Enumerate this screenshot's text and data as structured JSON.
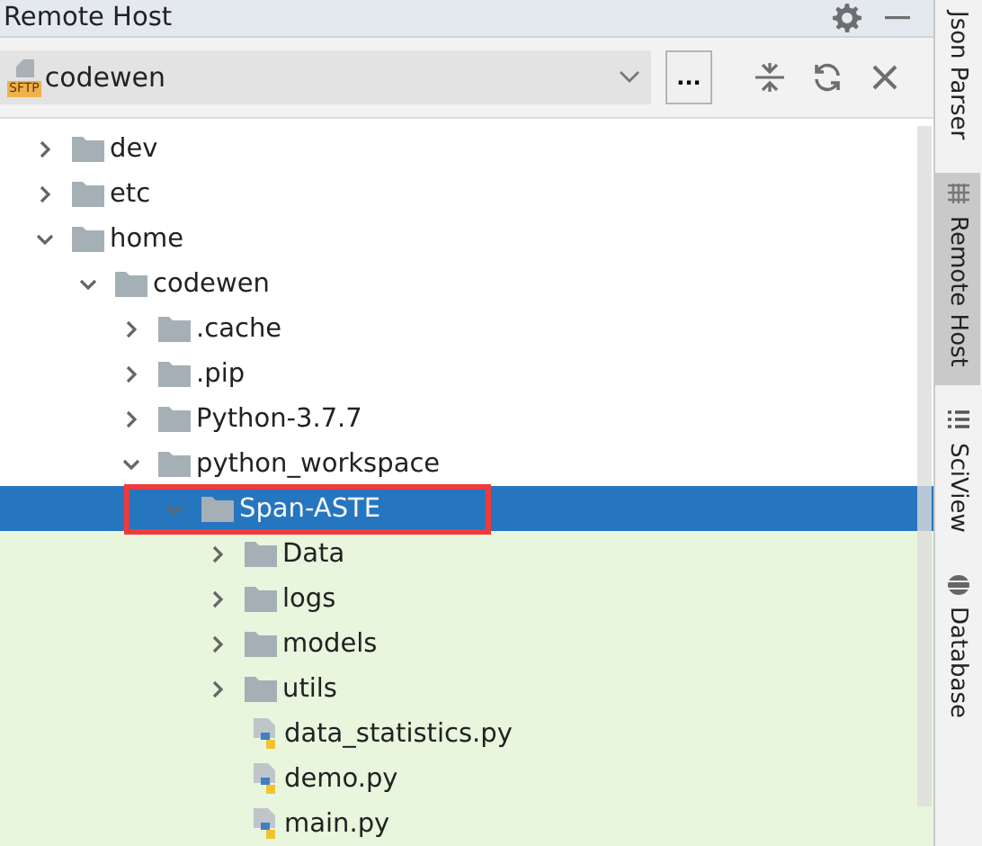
{
  "panel": {
    "title": "Remote Host"
  },
  "connection": {
    "badge": "SFTP",
    "name": "codewen",
    "more_button": "..."
  },
  "tree": [
    {
      "label": "dev",
      "kind": "folder",
      "expanded": false,
      "selected": false,
      "highlighted": false
    },
    {
      "label": "etc",
      "kind": "folder",
      "expanded": false,
      "selected": false,
      "highlighted": false
    },
    {
      "label": "home",
      "kind": "folder",
      "expanded": true,
      "selected": false,
      "highlighted": false,
      "children": [
        {
          "label": "codewen",
          "kind": "folder",
          "expanded": true,
          "selected": false,
          "highlighted": false,
          "children": [
            {
              "label": ".cache",
              "kind": "folder",
              "expanded": false,
              "selected": false,
              "highlighted": false
            },
            {
              "label": ".pip",
              "kind": "folder",
              "expanded": false,
              "selected": false,
              "highlighted": false
            },
            {
              "label": "Python-3.7.7",
              "kind": "folder",
              "expanded": false,
              "selected": false,
              "highlighted": false
            },
            {
              "label": "python_workspace",
              "kind": "folder",
              "expanded": true,
              "selected": false,
              "highlighted": false,
              "children": [
                {
                  "label": "Span-ASTE",
                  "kind": "folder",
                  "expanded": true,
                  "selected": true,
                  "highlighted": true,
                  "children": [
                    {
                      "label": "Data",
                      "kind": "folder",
                      "expanded": false,
                      "selected": false,
                      "highlighted": false
                    },
                    {
                      "label": "logs",
                      "kind": "folder",
                      "expanded": false,
                      "selected": false,
                      "highlighted": false
                    },
                    {
                      "label": "models",
                      "kind": "folder",
                      "expanded": false,
                      "selected": false,
                      "highlighted": false
                    },
                    {
                      "label": "utils",
                      "kind": "folder",
                      "expanded": false,
                      "selected": false,
                      "highlighted": false
                    },
                    {
                      "label": "data_statistics.py",
                      "kind": "python-file",
                      "selected": false,
                      "highlighted": false
                    },
                    {
                      "label": "demo.py",
                      "kind": "python-file",
                      "selected": false,
                      "highlighted": false
                    },
                    {
                      "label": "main.py",
                      "kind": "python-file",
                      "selected": false,
                      "highlighted": false
                    }
                  ]
                }
              ]
            }
          ]
        }
      ]
    }
  ],
  "side_tabs": [
    {
      "label": "Json Parser",
      "kind": "plain",
      "selected": false
    },
    {
      "label": "Remote Host",
      "kind": "grid",
      "selected": true
    },
    {
      "label": "SciView",
      "kind": "list",
      "selected": false
    },
    {
      "label": "Database",
      "kind": "database",
      "selected": false
    }
  ]
}
